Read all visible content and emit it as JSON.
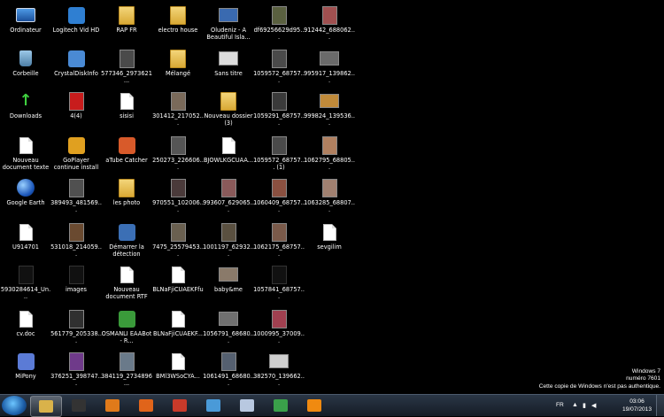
{
  "desktop": {
    "icons": [
      {
        "label": "Ordinateur",
        "kind": "pc"
      },
      {
        "label": "Corbeille",
        "kind": "bin"
      },
      {
        "label": "Downloads",
        "kind": "arrow"
      },
      {
        "label": "Nouveau document texte",
        "kind": "doc"
      },
      {
        "label": "Google Earth",
        "kind": "globe"
      },
      {
        "label": "U914701",
        "kind": "doc"
      },
      {
        "label": "5930284614_Un...",
        "kind": "dark"
      },
      {
        "label": "cv.doc",
        "kind": "doc"
      },
      {
        "label": "MiPony",
        "kind": "app",
        "color": "#5b7bd6"
      },
      {
        "label": "Logitech Vid HD",
        "kind": "app",
        "color": "#2f7fd2"
      },
      {
        "label": "CrystalDiskInfo",
        "kind": "app",
        "color": "#4a8ad4"
      },
      {
        "label": "4(4)",
        "kind": "photo",
        "color": "#c81c1c"
      },
      {
        "label": "GoPlayer continue install",
        "kind": "app",
        "color": "#e0a020"
      },
      {
        "label": "389493_481569...",
        "kind": "photo",
        "color": "#505050"
      },
      {
        "label": "531018_214059...",
        "kind": "photo",
        "color": "#6a4a30"
      },
      {
        "label": "images",
        "kind": "dark"
      },
      {
        "label": "561779_205338...",
        "kind": "photo",
        "color": "#303030"
      },
      {
        "label": "376251_398747...",
        "kind": "photo",
        "color": "#6f3a8a"
      },
      {
        "label": "RAP FR",
        "kind": "folder"
      },
      {
        "label": "577346_2973621...",
        "kind": "photo",
        "color": "#4a4a4a"
      },
      {
        "label": "sisisi",
        "kind": "doc"
      },
      {
        "label": "aTube Catcher",
        "kind": "app",
        "color": "#d85a2a"
      },
      {
        "label": "les photo",
        "kind": "folder"
      },
      {
        "label": "Démarrer la détection",
        "kind": "app",
        "color": "#3b6fb5"
      },
      {
        "label": "Nouveau document RTF",
        "kind": "doc"
      },
      {
        "label": "OSMANLI EAABot - R...",
        "kind": "app",
        "color": "#3a9a3a"
      },
      {
        "label": "384119_2734896...",
        "kind": "photo",
        "color": "#6a7a8a"
      },
      {
        "label": "electro house",
        "kind": "folder"
      },
      {
        "label": "Mélangé",
        "kind": "folder"
      },
      {
        "label": "301412_217052...",
        "kind": "photo",
        "color": "#7a6a5a"
      },
      {
        "label": "250273_226606...",
        "kind": "photo",
        "color": "#555"
      },
      {
        "label": "970551_102006...",
        "kind": "photo",
        "color": "#4a3a3a"
      },
      {
        "label": "7475_25579453...",
        "kind": "photo",
        "color": "#6a6050"
      },
      {
        "label": "BLNaFjiCUAEKFfu",
        "kind": "doc"
      },
      {
        "label": "BLNaFjiCUAEKF...",
        "kind": "doc"
      },
      {
        "label": "BMl3WSoCYA...",
        "kind": "doc"
      },
      {
        "label": "Oludeniz - A Beautiful Isla...",
        "kind": "wide",
        "color": "#3a6ab0"
      },
      {
        "label": "Sans titre",
        "kind": "wide",
        "color": "#ddd"
      },
      {
        "label": "Nouveau dossier (3)",
        "kind": "folder"
      },
      {
        "label": "BJOWLKGCUAA...",
        "kind": "doc"
      },
      {
        "label": "993607_629065...",
        "kind": "photo",
        "color": "#8a5a5a"
      },
      {
        "label": "1001197_62932...",
        "kind": "photo",
        "color": "#5a5040"
      },
      {
        "label": "baby&me",
        "kind": "wide",
        "color": "#8a7a6a"
      },
      {
        "label": "1056791_68680...",
        "kind": "wide",
        "color": "#707070"
      },
      {
        "label": "1061491_68680...",
        "kind": "photo",
        "color": "#556070"
      },
      {
        "label": "df69256629d95...",
        "kind": "photo",
        "color": "#5a6040"
      },
      {
        "label": "1059572_68757...",
        "kind": "photo",
        "color": "#4a4a4a"
      },
      {
        "label": "1059291_68757...",
        "kind": "photo",
        "color": "#3a3a3a"
      },
      {
        "label": "1059572_68757... (1)",
        "kind": "photo",
        "color": "#4a4a4a"
      },
      {
        "label": "1060409_68757...",
        "kind": "photo",
        "color": "#8a5040"
      },
      {
        "label": "1062175_68757...",
        "kind": "photo",
        "color": "#7a5a4a"
      },
      {
        "label": "1057841_68757...",
        "kind": "dark"
      },
      {
        "label": "1000995_37009...",
        "kind": "photo",
        "color": "#a04050"
      },
      {
        "label": "382570_139662...",
        "kind": "wide",
        "color": "#cfcfcf"
      },
      {
        "label": "912442_688062...",
        "kind": "photo",
        "color": "#a05050"
      },
      {
        "label": "995917_139862...",
        "kind": "wide",
        "color": "#6a6a6a"
      },
      {
        "label": "999824_139536...",
        "kind": "wide",
        "color": "#c08a3a"
      },
      {
        "label": "1062795_68805...",
        "kind": "photo",
        "color": "#b08060"
      },
      {
        "label": "1063285_68807...",
        "kind": "photo",
        "color": "#a08070"
      },
      {
        "label": "sevgilim",
        "kind": "doc"
      }
    ]
  },
  "watermark": {
    "line1": "Windows 7",
    "line2": "numéro 7601",
    "line3": "Cette copie de Windows n'est pas authentique."
  },
  "taskbar": {
    "pinned": [
      {
        "name": "explorer",
        "color": "#d9b24a"
      },
      {
        "name": "studio",
        "color": "#333"
      },
      {
        "name": "media-player",
        "color": "#e07a1a"
      },
      {
        "name": "firefox",
        "color": "#e0641a"
      },
      {
        "name": "ccleaner",
        "color": "#c83a2a"
      },
      {
        "name": "itunes",
        "color": "#4a9ad8"
      },
      {
        "name": "document",
        "color": "#b8c8e0"
      },
      {
        "name": "chrome",
        "color": "#3aa04a"
      },
      {
        "name": "vlc",
        "color": "#f08a10"
      }
    ],
    "language": "FR",
    "time": "03:06",
    "date": "19/07/2013"
  }
}
